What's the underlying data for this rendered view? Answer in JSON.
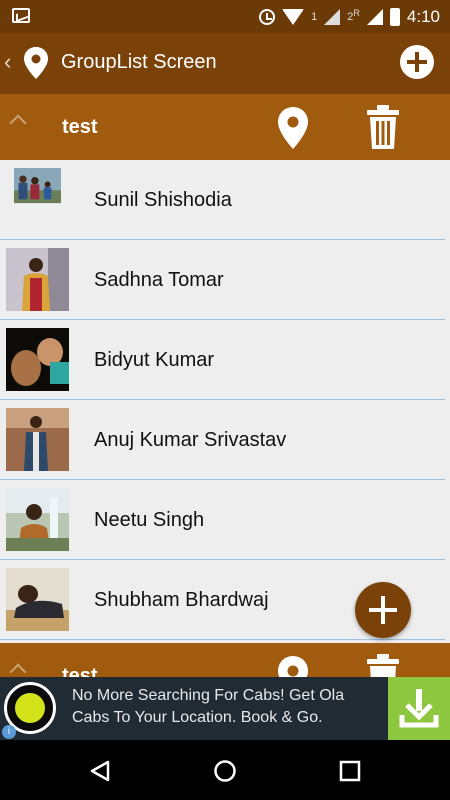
{
  "status_bar": {
    "sim1_label": "1",
    "sim2_label": "2",
    "sim2_badge": "R",
    "time": "4:10"
  },
  "app_bar": {
    "title": "GroupList Screen"
  },
  "groups": [
    {
      "name": "test"
    },
    {
      "name": "test"
    }
  ],
  "members": [
    {
      "name": "Sunil Shishodia"
    },
    {
      "name": "Sadhna Tomar"
    },
    {
      "name": "Bidyut Kumar"
    },
    {
      "name": "Anuj Kumar Srivastav"
    },
    {
      "name": "Neetu Singh"
    },
    {
      "name": "Shubham Bhardwaj"
    }
  ],
  "ad": {
    "text": "No More Searching For Cabs! Get Ola Cabs To Your Location. Book & Go.",
    "info_symbol": "i"
  },
  "colors": {
    "app_bar": "#7a4208",
    "group_header": "#a05b0f",
    "list_background": "#eeeeee",
    "row_divider": "#9ec4e4",
    "ad_download": "#8dc63f"
  },
  "icons": [
    "map-pin-icon",
    "trash-icon",
    "plus-icon",
    "chevron-up-icon",
    "download-icon",
    "back-icon",
    "home-icon",
    "recents-icon"
  ]
}
